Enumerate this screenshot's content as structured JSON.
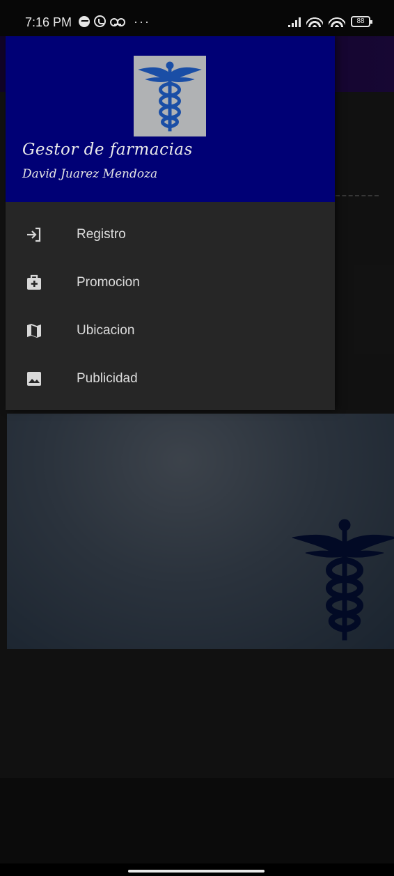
{
  "status_bar": {
    "time": "7:16 PM",
    "battery_level": "88",
    "icons": [
      "messenger-icon",
      "whatsapp-icon",
      "voicemail-icon",
      "more-dots-icon",
      "signal-icon",
      "wifi-icon",
      "wifi-icon",
      "battery-icon"
    ]
  },
  "drawer": {
    "header": {
      "title": "Gestor de farmacias",
      "subtitle": "David Juarez Mendoza",
      "background_color": "#000075",
      "logo_icon": "caduceus-icon"
    },
    "items": [
      {
        "label": "Registro",
        "icon": "login-icon"
      },
      {
        "label": "Promocion",
        "icon": "medical-bag-icon"
      },
      {
        "label": "Ubicacion",
        "icon": "map-icon"
      },
      {
        "label": "Publicidad",
        "icon": "image-icon"
      }
    ]
  },
  "background_app": {
    "toolbar_color": "#2a0b63",
    "hero_icon": "caduceus-icon"
  },
  "colors": {
    "drawer_bg": "#262626",
    "menu_text": "#dcdcdc",
    "icon_color": "#d8d8d8"
  }
}
